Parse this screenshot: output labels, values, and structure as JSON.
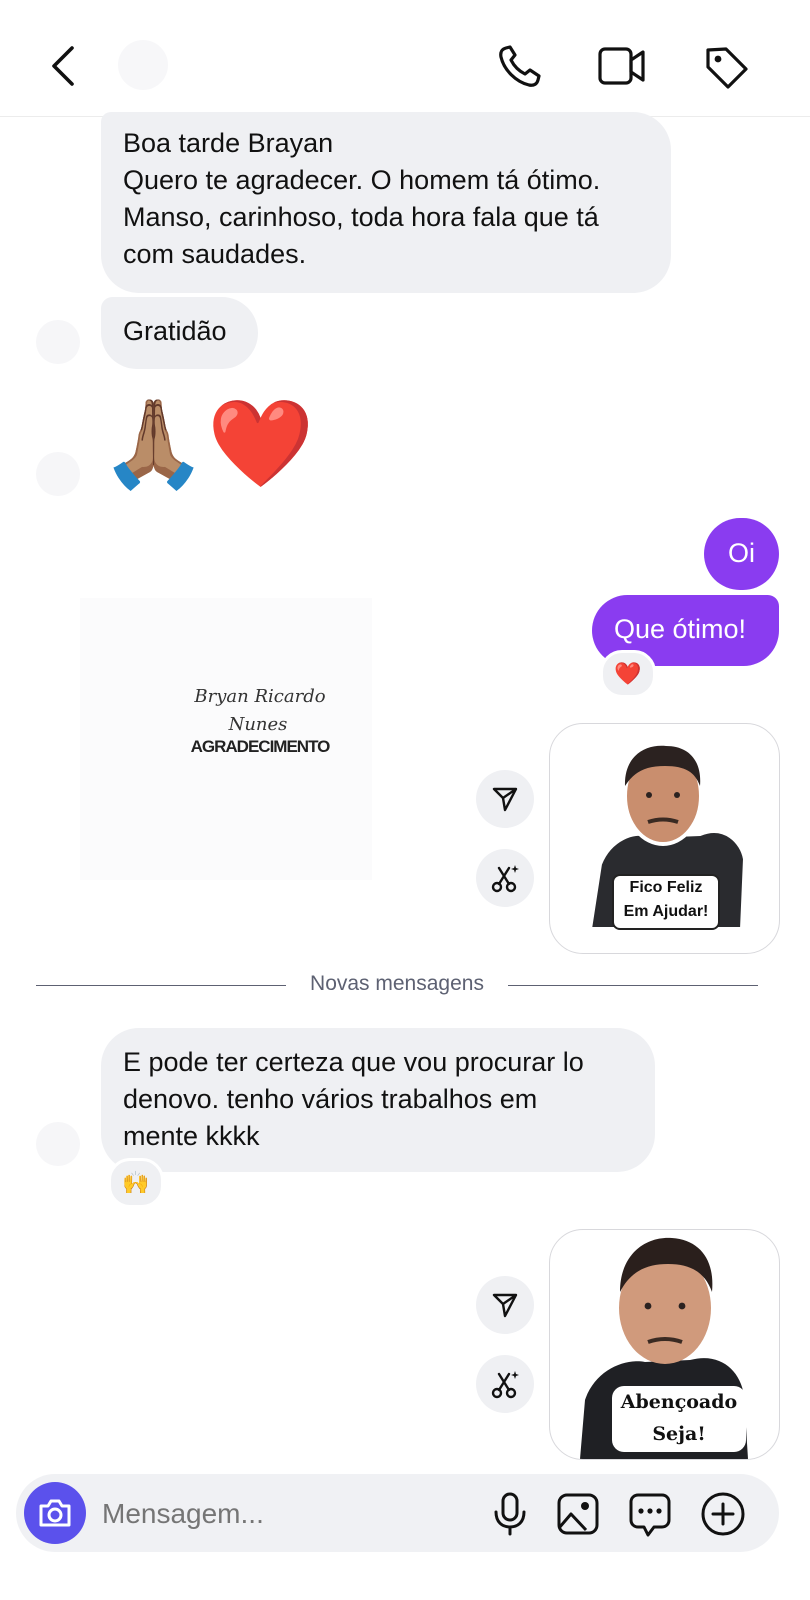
{
  "colors": {
    "accent": "#8a3cf0",
    "incoming_bubble": "#eff0f3",
    "camera_button": "#5b51ec",
    "icon": "#111111"
  },
  "header": {
    "back_icon": "chevron-left-icon",
    "actions": [
      "phone-icon",
      "video-camera-icon",
      "tag-icon"
    ]
  },
  "messages": {
    "msg1_lines": [
      "Boa tarde Brayan",
      "Quero te agradecer. O homem tá ótimo.",
      "Manso, carinhoso, toda hora fala que tá",
      "com saudades."
    ],
    "msg2": "Gratidão",
    "emojis": "🙏🏽❤️",
    "out1": "Oi",
    "out2": "Que ótimo!",
    "out2_reaction": "❤️",
    "card": {
      "line1": "Bryan Ricardo",
      "line2": "Nunes",
      "line3": "AGRADECIMENTO"
    },
    "sticker1_caption": [
      "Fico Feliz",
      "Em Ajudar!"
    ],
    "divider": "Novas mensagens",
    "msg3_lines": [
      "E pode ter certeza que vou procurar lo",
      "denovo. tenho vários trabalhos em",
      "mente kkkk"
    ],
    "msg3_reaction": "🙌",
    "sticker2_caption": [
      "Abençoado",
      "Seja!"
    ]
  },
  "sticker_actions": [
    "send-icon",
    "remix-icon"
  ],
  "composer": {
    "placeholder": "Mensagem...",
    "icons": [
      "camera-icon",
      "microphone-icon",
      "gallery-icon",
      "chat-bubble-icon",
      "plus-circle-icon"
    ]
  }
}
